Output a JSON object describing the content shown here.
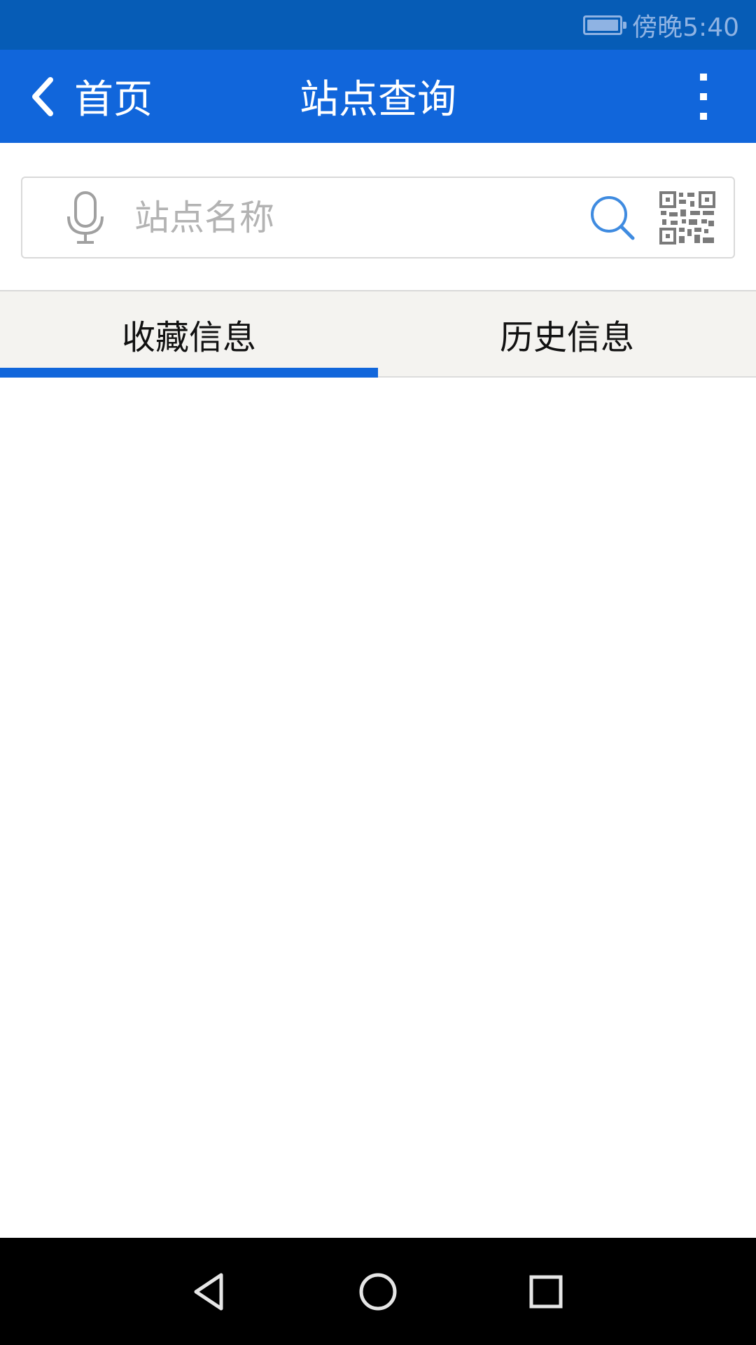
{
  "status_bar": {
    "time": "傍晚5:40",
    "battery_icon": "battery-icon"
  },
  "app_bar": {
    "back_label": "首页",
    "title": "站点查询",
    "back_icon": "chevron-left-icon",
    "more_icon": "more-vertical-icon"
  },
  "search": {
    "placeholder": "站点名称",
    "value": "",
    "mic_icon": "microphone-icon",
    "search_icon": "search-icon",
    "qr_icon": "qr-code-icon"
  },
  "tabs": [
    {
      "label": "收藏信息",
      "selected": true
    },
    {
      "label": "历史信息",
      "selected": false
    }
  ],
  "nav_bar": {
    "back_icon": "nav-back-icon",
    "home_icon": "nav-home-icon",
    "recents_icon": "nav-recents-icon"
  },
  "colors": {
    "status_bar": "#065cb6",
    "app_bar": "#1166db",
    "accent": "#1166db",
    "tab_background": "#f4f3f0"
  }
}
